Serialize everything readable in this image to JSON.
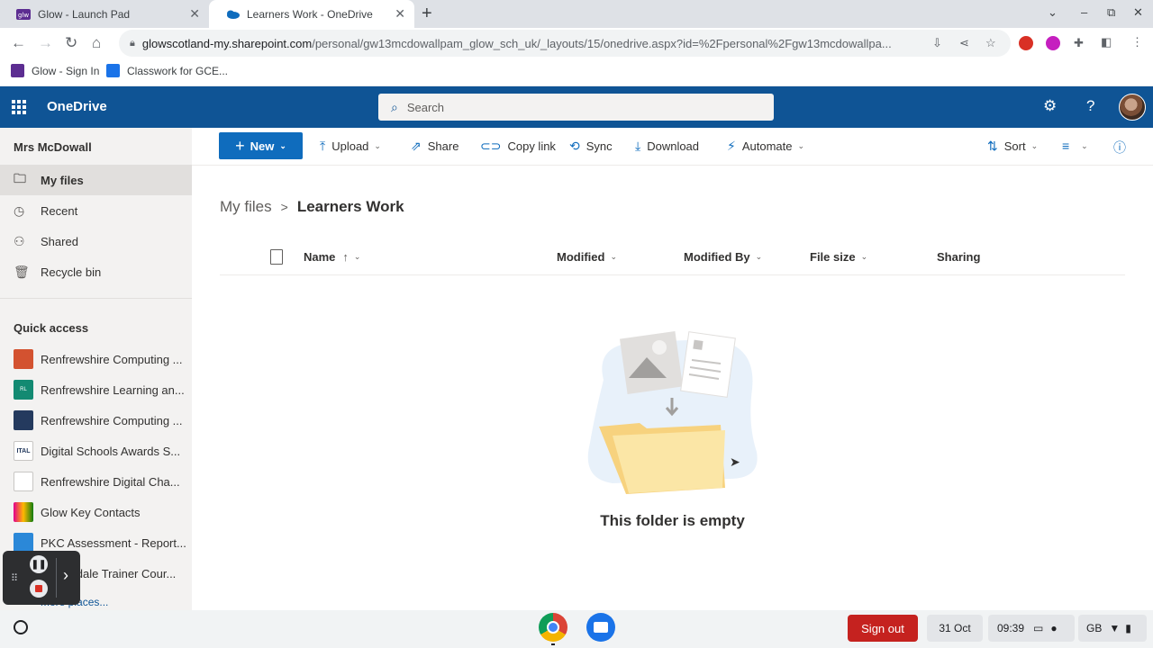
{
  "browser": {
    "tabs": [
      {
        "title": "Glow - Launch Pad",
        "favicon": "glow-icon"
      },
      {
        "title": "Learners Work - OneDrive",
        "favicon": "onedrive-cloud-icon"
      }
    ],
    "url_host": "glowscotland-my.sharepoint.com",
    "url_path": "/personal/gw13mcdowallpam_glow_sch_uk/_layouts/15/onedrive.aspx?id=%2Fpersonal%2Fgw13mcdowallpa...",
    "bookmarks": [
      {
        "label": "Glow - Sign In"
      },
      {
        "label": "Classwork for GCE..."
      }
    ]
  },
  "suitebar": {
    "app_name": "OneDrive",
    "search_placeholder": "Search"
  },
  "leftnav": {
    "user": "Mrs McDowall",
    "items": [
      {
        "label": "My files",
        "icon": "folder-icon",
        "active": true
      },
      {
        "label": "Recent",
        "icon": "clock-icon"
      },
      {
        "label": "Shared",
        "icon": "people-icon"
      },
      {
        "label": "Recycle bin",
        "icon": "trash-icon"
      }
    ],
    "quick_access_title": "Quick access",
    "quick_access": [
      {
        "label": "Renfrewshire Computing ...",
        "color": "#d35230"
      },
      {
        "label": "Renfrewshire Learning an...",
        "color": "#138a72"
      },
      {
        "label": "Renfrewshire Computing ...",
        "color": "#243a5e"
      },
      {
        "label": "Digital Schools Awards S...",
        "color": "#ffffff"
      },
      {
        "label": "Renfrewshire Digital Cha...",
        "color": "#ffffff"
      },
      {
        "label": "Glow Key Contacts",
        "color": "#e3008c"
      },
      {
        "label": "PKC Assessment - Report...",
        "color": "#2b88d8"
      },
      {
        "label": "Clydesdale Trainer Cour...",
        "color": "#605e5c"
      }
    ],
    "more_places": "More places..."
  },
  "commands": {
    "new": "New",
    "upload": "Upload",
    "share": "Share",
    "copy_link": "Copy link",
    "sync": "Sync",
    "download": "Download",
    "automate": "Automate",
    "sort": "Sort"
  },
  "breadcrumb": {
    "root": "My files",
    "current": "Learners Work"
  },
  "columns": {
    "name": "Name",
    "modified": "Modified",
    "modified_by": "Modified By",
    "file_size": "File size",
    "sharing": "Sharing"
  },
  "empty_message": "This folder is empty",
  "shelf": {
    "sign_out": "Sign out",
    "date": "31 Oct",
    "time": "09:39",
    "locale": "GB"
  },
  "colors": {
    "suitebar": "#0f5495",
    "accent": "#0f6cbd",
    "signout": "#c5221f"
  }
}
